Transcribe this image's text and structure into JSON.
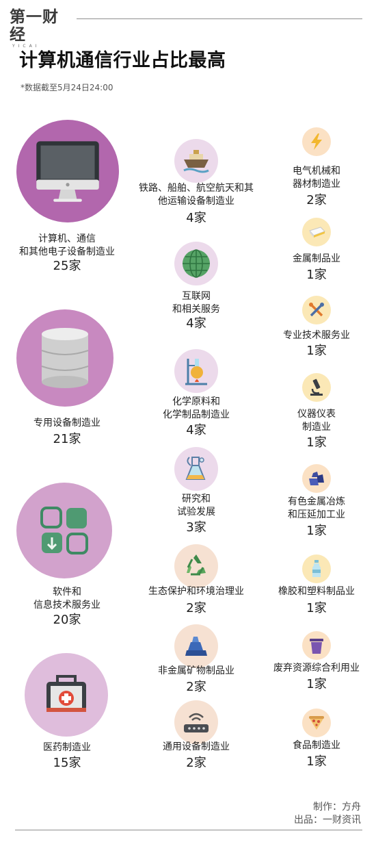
{
  "header": {
    "logo_text": "第一财经",
    "logo_sub": "YICAI",
    "title": "计算机通信行业占比最高",
    "note": "*数据截至5月24日24:00"
  },
  "col_left": [
    {
      "icon": "monitor-icon",
      "label": "计算机、通信\n和其他电子设备制造业",
      "count": "25家"
    },
    {
      "icon": "database-icon",
      "label": "专用设备制造业",
      "count": "21家"
    },
    {
      "icon": "apps-icon",
      "label": "软件和\n信息技术服务业",
      "count": "20家"
    },
    {
      "icon": "medical-kit-icon",
      "label": "医药制造业",
      "count": "15家"
    }
  ],
  "col_mid": [
    {
      "icon": "ship-icon",
      "label": "铁路、船舶、航空航天和其\n他运输设备制造业",
      "count": "4家"
    },
    {
      "icon": "globe-icon",
      "label": "互联网\n和相关服务",
      "count": "4家"
    },
    {
      "icon": "flask-burner-icon",
      "label": "化学原料和\n化学制品制造业",
      "count": "4家"
    },
    {
      "icon": "lab-flask-icon",
      "label": "研究和\n试验发展",
      "count": "3家"
    },
    {
      "icon": "recycle-icon",
      "label": "生态保护和环境治理业",
      "count": "2家"
    },
    {
      "icon": "mineral-icon",
      "label": "非金属矿物制品业",
      "count": "2家"
    },
    {
      "icon": "router-icon",
      "label": "通用设备制造业",
      "count": "2家"
    }
  ],
  "col_right": [
    {
      "icon": "lightning-icon",
      "label": "电气机械和\n器材制造业",
      "count": "2家"
    },
    {
      "icon": "metal-bar-icon",
      "label": "金属制品业",
      "count": "1家"
    },
    {
      "icon": "tools-icon",
      "label": "专业技术服务业",
      "count": "1家"
    },
    {
      "icon": "microscope-icon",
      "label": "仪器仪表\n制造业",
      "count": "1家"
    },
    {
      "icon": "ore-icon",
      "label": "有色金属冶炼\n和压延加工业",
      "count": "1家"
    },
    {
      "icon": "bottle-icon",
      "label": "橡胶和塑料制品业",
      "count": "1家"
    },
    {
      "icon": "trash-bin-icon",
      "label": "废弃资源综合利用业",
      "count": "1家"
    },
    {
      "icon": "pizza-icon",
      "label": "食品制造业",
      "count": "1家"
    }
  ],
  "footer": {
    "author": "制作：方舟",
    "source": "出品：一财资讯"
  }
}
